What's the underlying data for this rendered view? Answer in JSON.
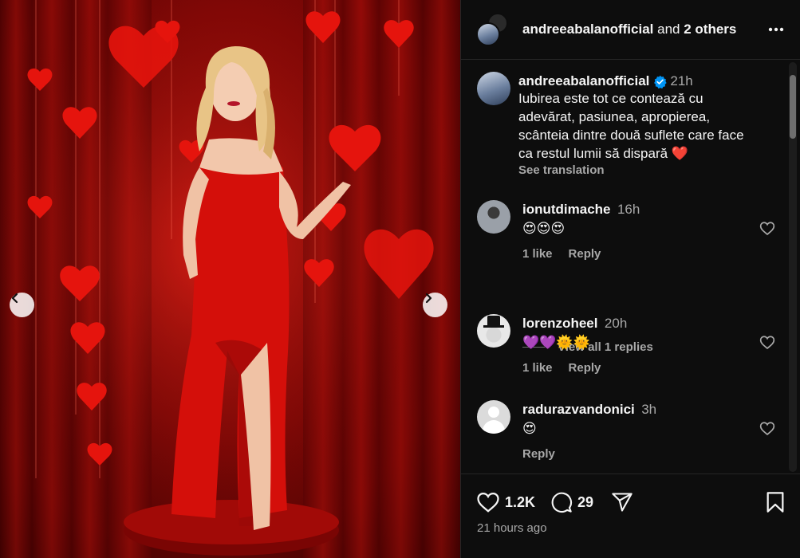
{
  "header": {
    "username": "andreeabalanofficial",
    "and_text": "and",
    "others": "2 others"
  },
  "caption": {
    "username": "andreeabalanofficial",
    "time": "21h",
    "text_lines": [
      "Iubirea este tot ce contează cu",
      "adevărat, pasiunea, apropierea,",
      "scânteia dintre două suflete care face",
      "ca restul lumii să dispară ❤️"
    ],
    "see_translation": "See translation"
  },
  "comments": [
    {
      "username": "ionutdimache",
      "time": "16h",
      "text": "😍😍😍",
      "likes": "1 like",
      "reply": "Reply",
      "view_replies": "View all 1 replies"
    },
    {
      "username": "lorenzoheel",
      "time": "20h",
      "text": "💜💜🌞🌞",
      "likes": "1 like",
      "reply": "Reply"
    },
    {
      "username": "radurazvandonici",
      "time": "3h",
      "text": "😍",
      "reply": "Reply"
    }
  ],
  "actions": {
    "likes": "1.2K",
    "comments": "29",
    "posted": "21 hours ago"
  },
  "colors": {
    "panel_bg": "#0d0d0d",
    "verified": "#0095f6",
    "muted": "#a8a8a8",
    "photo_red": "#c9150f"
  },
  "icons": [
    "chevron-left-icon",
    "chevron-right-icon",
    "more-icon",
    "verified-icon",
    "heart-icon",
    "comment-icon",
    "share-icon",
    "bookmark-icon"
  ]
}
